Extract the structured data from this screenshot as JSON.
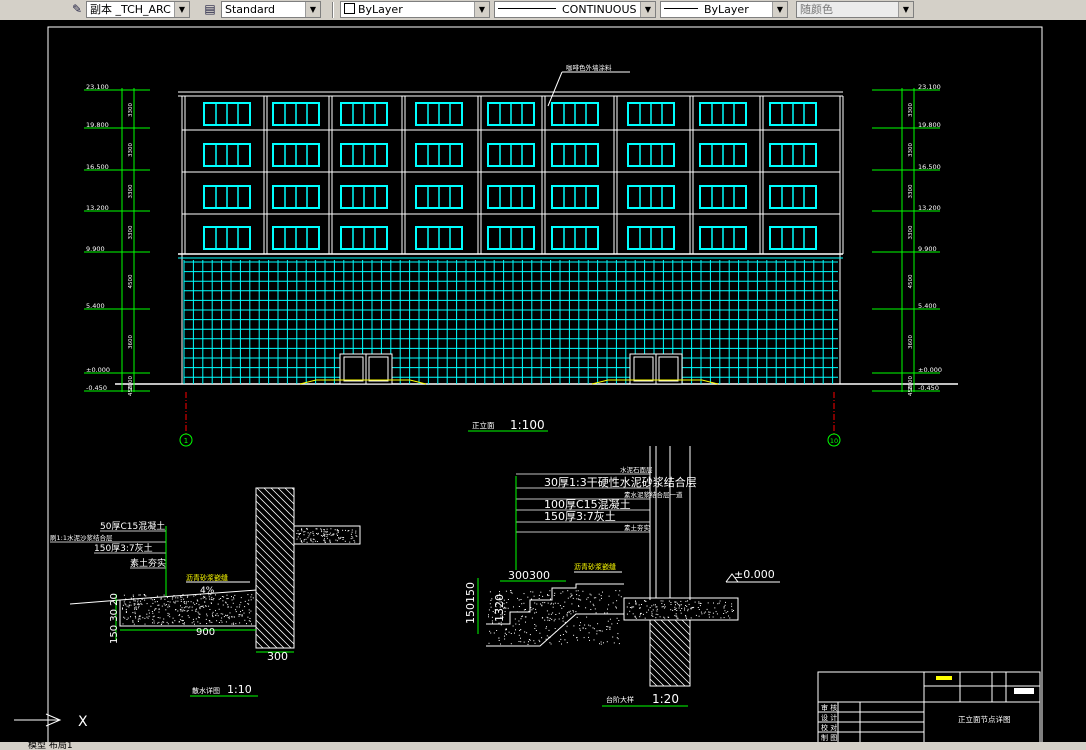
{
  "toolbar": {
    "textstyle_label": "副本 _TCH_ARC",
    "dimstyle_label": "Standard",
    "layer_label": "ByLayer",
    "linetype_label": "CONTINUOUS",
    "lineweight_label": "ByLayer",
    "color_label": "随颜色"
  },
  "drawing": {
    "main_title": "正立面",
    "main_scale": "1:100",
    "callout_top": "咖啡色外墙涂料",
    "elev_left": [
      "23.100",
      "19.800",
      "16.500",
      "13.200",
      "9.900",
      "5.400",
      "±0.000",
      "-0.450"
    ],
    "elev_right": [
      "23.100",
      "19.800",
      "16.500",
      "13.200",
      "9.900",
      "5.400",
      "±0.000",
      "-0.450"
    ],
    "dims_left": [
      "3300",
      "3300",
      "3300",
      "3300",
      "4500",
      "3600",
      "2000",
      "450"
    ],
    "axis_left": "1",
    "axis_right": "10",
    "detail1": {
      "labels": [
        "50厚C15混凝土",
        "刷1:1水泥沙浆结合层",
        "150厚3:7灰土",
        "素土夯实",
        "沥青砂浆嵌缝"
      ],
      "slope": "4%",
      "width": "900",
      "wall": "300",
      "dims": "150 30 20",
      "title": "散水详图",
      "scale": "1:10"
    },
    "detail2": {
      "labels": [
        "水泥石面层",
        "30厚1:3干硬性水泥砂浆结合层",
        "素水泥浆结合层一道",
        "100厚C15混凝土",
        "150厚3:7灰土",
        "素土夯实"
      ],
      "dim_top": "300300",
      "callout": "沥青砂浆嵌缝",
      "elev": "±0.000",
      "dims_left": "150150",
      "dim_small": "1320",
      "title": "台阶大样",
      "scale": "1:20"
    },
    "titleblock": {
      "rows": [
        "审  核",
        "设  计",
        "校  对",
        "制  图"
      ],
      "drawing_name": "正立面节点详图"
    }
  },
  "ucs": {
    "x_label": "X"
  },
  "status": {
    "tabs_label": "模型 布局1"
  },
  "colors": {
    "background": "#000000",
    "cyan": "#00ffff",
    "green": "#00ff00",
    "yellow": "#ffff00",
    "white": "#ffffff"
  }
}
